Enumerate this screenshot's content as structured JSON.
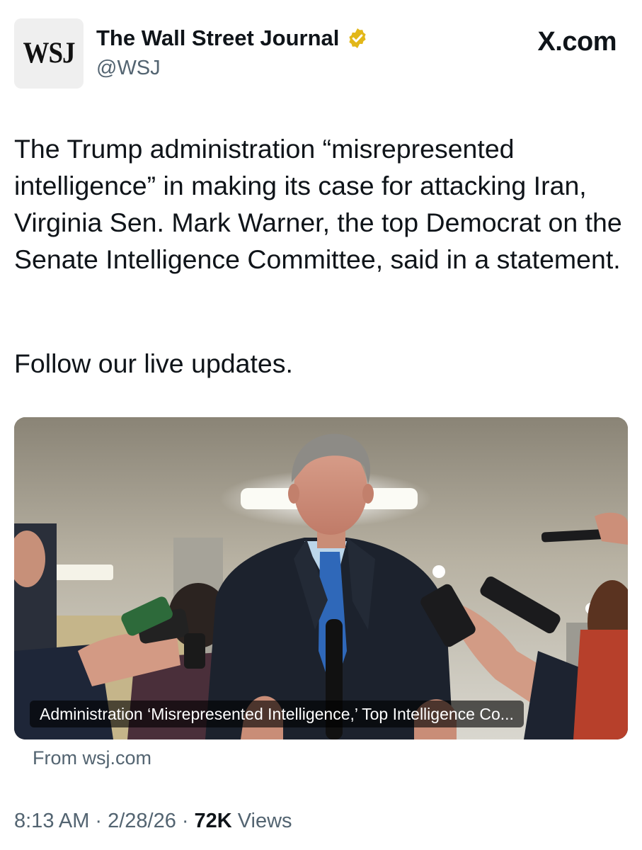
{
  "author": {
    "avatar_text": "WSJ",
    "name": "The Wall Street Journal",
    "handle": "@WSJ",
    "verified_icon": "gold-verified-badge-icon"
  },
  "source_label": "X.com",
  "tweet": {
    "text": "The Trump administration “misrepresented intelligence” in making its case for attacking Iran, Virginia Sen. Mark Warner, the top Democrat on the Senate Intelligence Committee, said in a statement.",
    "follow_text": "Follow our live updates."
  },
  "link_card": {
    "title": "Administration ‘Misrepresented Intelligence,’ Top Intelligence Co...",
    "domain": "From wsj.com"
  },
  "meta": {
    "time": "8:13 AM",
    "separator": "·",
    "date": "2/28/26",
    "views_count": "72K",
    "views_label": "Views"
  },
  "colors": {
    "text": "#0f1419",
    "secondary": "#536471",
    "verified_gold": "#e2b719"
  }
}
